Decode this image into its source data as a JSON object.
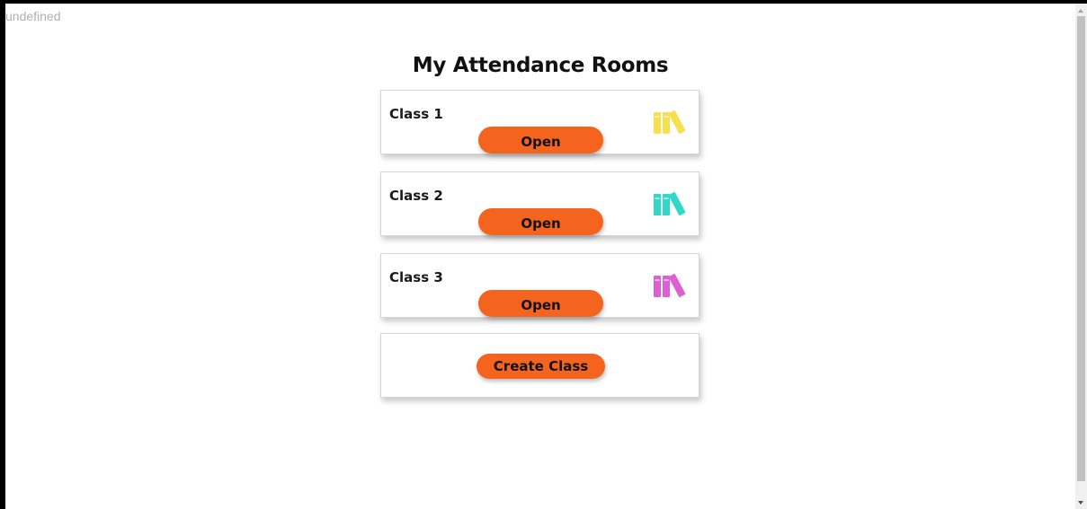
{
  "debug_text": "undefined",
  "page": {
    "title": "My Attendance Rooms"
  },
  "classes": [
    {
      "name": "Class 1",
      "button_label": "Open",
      "icon": "books-icon",
      "icon_color": "#f6e04d"
    },
    {
      "name": "Class 2",
      "button_label": "Open",
      "icon": "books-icon",
      "icon_color": "#2fd8c7"
    },
    {
      "name": "Class 3",
      "button_label": "Open",
      "icon": "books-icon",
      "icon_color": "#dc5fd3"
    }
  ],
  "create": {
    "button_label": "Create Class"
  },
  "colors": {
    "accent": "#f5641f"
  }
}
